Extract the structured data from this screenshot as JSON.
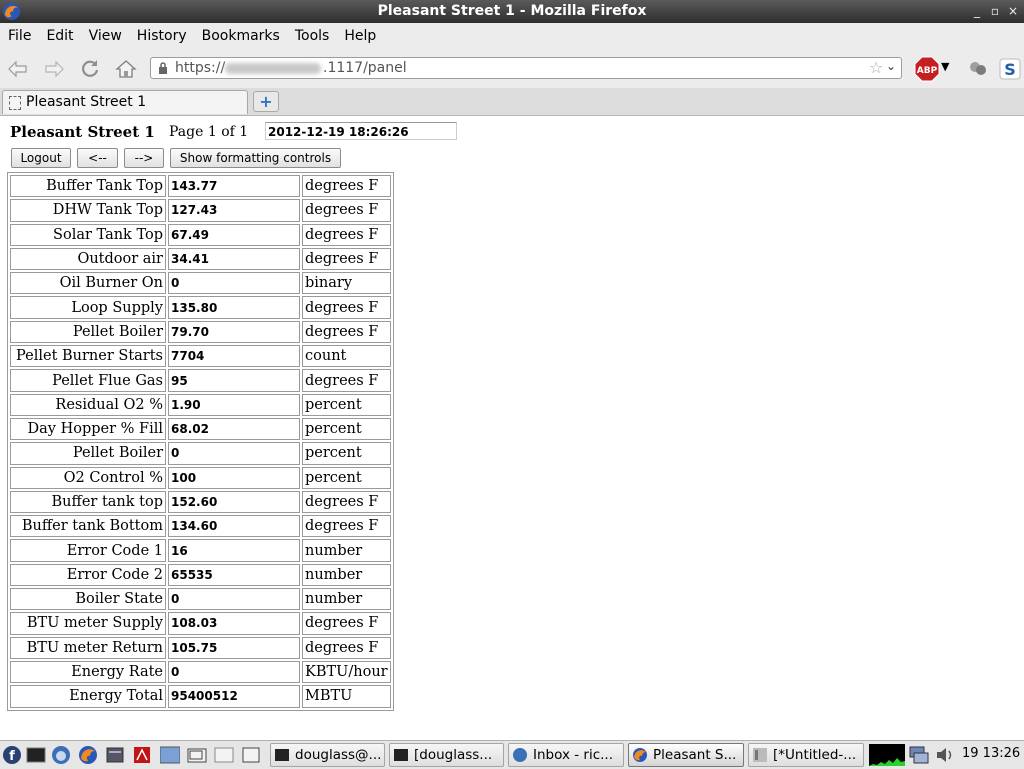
{
  "window": {
    "title": "Pleasant Street 1 - Mozilla Firefox",
    "controls": [
      "_",
      "▫",
      "×"
    ]
  },
  "menu": [
    "File",
    "Edit",
    "View",
    "History",
    "Bookmarks",
    "Tools",
    "Help"
  ],
  "url": {
    "prefix": "https://",
    "suffix": ".1117/panel"
  },
  "tab": {
    "label": "Pleasant Street 1",
    "new_tab": "+"
  },
  "page": {
    "title": "Pleasant Street 1",
    "page_label": "Page 1 of 1",
    "timestamp": "2012-12-19 18:26:26",
    "buttons": {
      "logout": "Logout",
      "prev": "<--",
      "next": "-->",
      "formatting": "Show formatting controls"
    },
    "rows": [
      {
        "label": "Buffer Tank Top",
        "value": "143.77",
        "unit": "degrees F"
      },
      {
        "label": "DHW Tank Top",
        "value": "127.43",
        "unit": "degrees F"
      },
      {
        "label": "Solar Tank Top",
        "value": "67.49",
        "unit": "degrees F"
      },
      {
        "label": "Outdoor air",
        "value": "34.41",
        "unit": "degrees F"
      },
      {
        "label": "Oil Burner On",
        "value": "0",
        "unit": "binary"
      },
      {
        "label": "Loop Supply",
        "value": "135.80",
        "unit": "degrees F"
      },
      {
        "label": "Pellet Boiler",
        "value": "79.70",
        "unit": "degrees F"
      },
      {
        "label": "Pellet Burner Starts",
        "value": "7704",
        "unit": "count"
      },
      {
        "label": "Pellet Flue Gas",
        "value": "95",
        "unit": "degrees F"
      },
      {
        "label": "Residual O2 %",
        "value": "1.90",
        "unit": "percent"
      },
      {
        "label": "Day Hopper % Fill",
        "value": "68.02",
        "unit": "percent"
      },
      {
        "label": "Pellet Boiler",
        "value": "0",
        "unit": "percent"
      },
      {
        "label": "O2 Control %",
        "value": "100",
        "unit": "percent"
      },
      {
        "label": "Buffer tank top",
        "value": "152.60",
        "unit": "degrees F"
      },
      {
        "label": "Buffer tank Bottom",
        "value": "134.60",
        "unit": "degrees F"
      },
      {
        "label": "Error Code 1",
        "value": "16",
        "unit": "number"
      },
      {
        "label": "Error Code 2",
        "value": "65535",
        "unit": "number"
      },
      {
        "label": "Boiler State",
        "value": "0",
        "unit": "number"
      },
      {
        "label": "BTU meter Supply",
        "value": "108.03",
        "unit": "degrees F"
      },
      {
        "label": "BTU meter Return",
        "value": "105.75",
        "unit": "degrees F"
      },
      {
        "label": "Energy Rate",
        "value": "0",
        "unit": "KBTU/hour"
      },
      {
        "label": "Energy Total",
        "value": "95400512",
        "unit": "MBTU"
      }
    ]
  },
  "taskbar": {
    "tasks": [
      "douglass@...",
      "[douglass...",
      "Inbox - ric...",
      "Pleasant S...",
      "[*Untitled-..."
    ],
    "clock": "19 13:26"
  },
  "colors": {
    "titlebar": "#3a3a3a",
    "chrome": "#ececec",
    "abp_red": "#c51f1f",
    "link_blue": "#3a6fc4"
  }
}
